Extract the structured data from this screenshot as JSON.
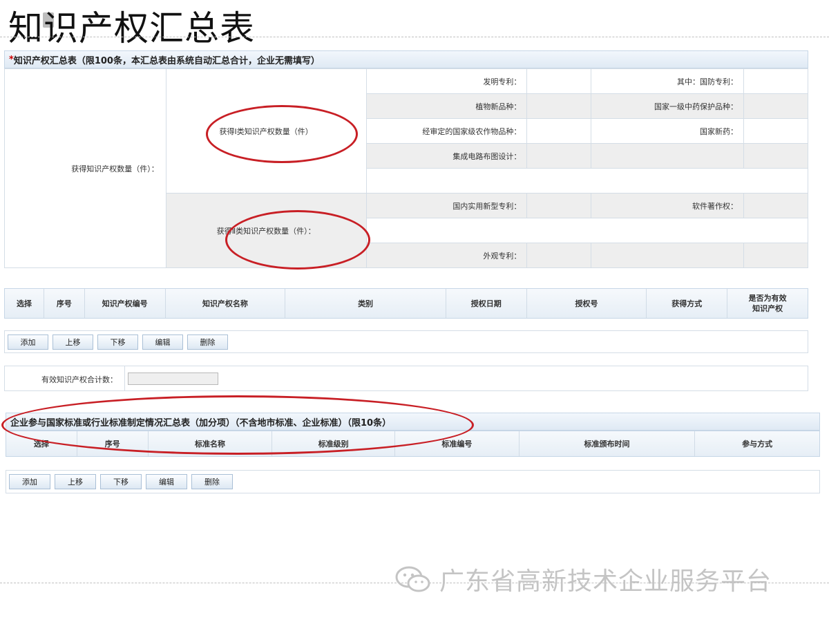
{
  "slide": {
    "title": "知识产权汇总表"
  },
  "summary": {
    "required_mark": "*",
    "header": "知识产权汇总表（限100条，本汇总表由系统自动汇总合计，企业无需填写）",
    "total_label": "获得知识产权数量（件）：",
    "class1_label": "获得Ⅰ类知识产权数量（件）",
    "class2_label": "获得Ⅱ类知识产权数量（件）：",
    "rows": {
      "invention_patent": "发明专利：",
      "defense_patent": "其中：国防专利：",
      "plant_variety": "植物新品种：",
      "tcm_protection": "国家一级中药保护品种：",
      "crop_variety": "经审定的国家级农作物品种：",
      "new_drug": "国家新药：",
      "ic_layout": "集成电路布图设计：",
      "utility_model": "国内实用新型专利：",
      "software_copyright": "软件著作权：",
      "design_patent": "外观专利："
    }
  },
  "ip_grid": {
    "columns": [
      "选择",
      "序号",
      "知识产权编号",
      "知识产权名称",
      "类别",
      "授权日期",
      "授权号",
      "获得方式",
      "是否为有效知识产权"
    ]
  },
  "ip_toolbar": {
    "add": "添加",
    "up": "上移",
    "down": "下移",
    "edit": "编辑",
    "delete": "删除"
  },
  "valid_total": {
    "label": "有效知识产权合计数：",
    "value": ""
  },
  "standards": {
    "header": "企业参与国家标准或行业标准制定情况汇总表（加分项）（不含地市标准、企业标准）（限10条）",
    "columns": [
      "选择",
      "序号",
      "标准名称",
      "标准级别",
      "标准编号",
      "标准颁布时间",
      "参与方式"
    ]
  },
  "std_toolbar": {
    "add": "添加",
    "up": "上移",
    "down": "下移",
    "edit": "编辑",
    "delete": "删除"
  },
  "watermark": {
    "text": "广东省高新技术企业服务平台"
  },
  "colors": {
    "annotation_red": "#c81f25",
    "header_blue": "#dfe9f4"
  }
}
